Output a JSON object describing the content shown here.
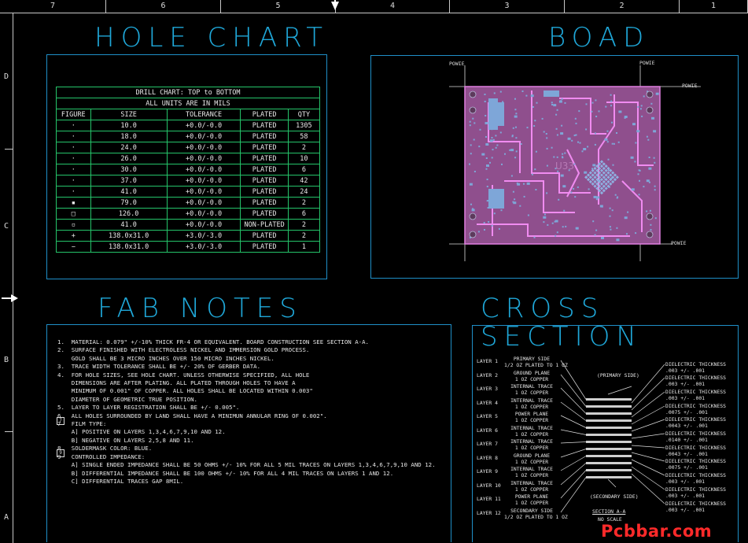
{
  "zones_top": [
    "7",
    "6",
    "5",
    "4",
    "3",
    "2",
    "1"
  ],
  "zones_left": [
    "D",
    "C",
    "B",
    "A"
  ],
  "titles": {
    "hole_chart": "HOLE CHART",
    "board": "BOAD",
    "fab_notes": "FAB NOTES",
    "cross_section": "CROSS SECTION"
  },
  "drill_chart": {
    "title": "DRILL CHART: TOP to BOTTOM",
    "subtitle": "ALL UNITS ARE IN MILS",
    "headers": [
      "FIGURE",
      "SIZE",
      "TOLERANCE",
      "PLATED",
      "QTY"
    ],
    "rows": [
      [
        "·",
        "10.0",
        "+0.0/-0.0",
        "PLATED",
        "1305"
      ],
      [
        "·",
        "18.0",
        "+0.0/-0.0",
        "PLATED",
        "58"
      ],
      [
        "·",
        "24.0",
        "+0.0/-0.0",
        "PLATED",
        "2"
      ],
      [
        "·",
        "26.0",
        "+0.0/-0.0",
        "PLATED",
        "10"
      ],
      [
        "·",
        "30.0",
        "+0.0/-0.0",
        "PLATED",
        "6"
      ],
      [
        "·",
        "37.0",
        "+0.0/-0.0",
        "PLATED",
        "42"
      ],
      [
        "·",
        "41.0",
        "+0.0/-0.0",
        "PLATED",
        "24"
      ],
      [
        "▪",
        "79.0",
        "+0.0/-0.0",
        "PLATED",
        "2"
      ],
      [
        "□",
        "126.0",
        "+0.0/-0.0",
        "PLATED",
        "6"
      ],
      [
        "▫",
        "41.0",
        "+0.0/-0.0",
        "NON-PLATED",
        "2"
      ],
      [
        "+",
        "138.0x31.0",
        "+3.0/-3.0",
        "PLATED",
        "2"
      ],
      [
        "−",
        "138.0x31.0",
        "+3.0/-3.0",
        "PLATED",
        "1"
      ]
    ]
  },
  "board": {
    "callouts": [
      "POWIE",
      "POWIE",
      "POWIE",
      "POWIE"
    ],
    "label": "U33"
  },
  "fab_notes": [
    "1.  MATERIAL: 0.079\" +/-10% THICK FR-4 OR EQUIVALENT. BOARD CONSTRUCTION SEE SECTION A-A.",
    "2.  SURFACE FINISHED WITH ELECTROLESS NICKEL AND IMMERSION GOLD PROCESS.",
    "    GOLD SHALL BE 3 MICRO INCHES OVER 150 MICRO INCHES NICKEL.",
    "3.  TRACE WIDTH TOLERANCE SHALL BE +/- 20% OF GERBER DATA.",
    "4.  FOR HOLE SIZES, SEE HOLE CHART. UNLESS OTHERWISE SPECIFIED, ALL HOLE",
    "    DIMENSIONS ARE AFTER PLATING. ALL PLATED THROUGH HOLES TO HAVE A",
    "    MINIMUM OF 0.001\" OF COPPER. ALL HOLES SHALL BE LOCATED WITHIN 0.003\"",
    "    DIAMETER OF GEOMETRIC TRUE POSITION.",
    "5.  LAYER TO LAYER REGISTRATION SHALL BE +/- 0.005\".",
    "6.  ALL HOLES SURROUNDED BY LAND SHALL HAVE A MINIMUN ANNULAR RING OF 0.002\".",
    "7   FILM TYPE:",
    "    A] POSITIVE ON LAYERS 1,3,4,6,7,9,10 AND 12.",
    "    B] NEGATIVE ON LAYERS 2,5,8 AND 11.",
    "8.  SOLDERMASK COLOR: BLUE.",
    "9   CONTROLLED IMPEDANCE:",
    "    A] SINGLE ENDED IMPEDANCE SHALL BE 50 OHMS +/- 10% FOR ALL 5 MIL TRACES ON LAYERS 1,3,4,6,7,9,10 AND 12.",
    "    B] DIFFERENTIAL IMPEDANCE SHALL BE 100 OHMS +/- 10% FOR ALL 4 MIL TRACES ON LAYERS 1 AND 12.",
    "    C] DIFFERENTIAL TRACES GAP 8MIL."
  ],
  "cross_section": {
    "layers": [
      {
        "layer": "LAYER 1",
        "desc": "PRIMARY SIDE\n1/2 OZ PLATED TO 1 OZ"
      },
      {
        "layer": "LAYER 2",
        "desc": "GROUND PLANE\n1 OZ COPPER"
      },
      {
        "layer": "LAYER 3",
        "desc": "INTERNAL TRACE\n1 OZ COPPER"
      },
      {
        "layer": "LAYER 4",
        "desc": "INTERNAL TRACE\n1 OZ COPPER"
      },
      {
        "layer": "LAYER 5",
        "desc": "POWER PLANE\n1 OZ COPPER"
      },
      {
        "layer": "LAYER 6",
        "desc": "INTERNAL TRACE\n1 OZ COPPER"
      },
      {
        "layer": "LAYER 7",
        "desc": "INTERNAL TRACE\n1 OZ COPPER"
      },
      {
        "layer": "LAYER 8",
        "desc": "GROUND PLANE\n1 OZ COPPER"
      },
      {
        "layer": "LAYER 9",
        "desc": "INTERNAL TRACE\n1 OZ COPPER"
      },
      {
        "layer": "LAYER 10",
        "desc": "INTERNAL TRACE\n1 OZ COPPER"
      },
      {
        "layer": "LAYER 11",
        "desc": "POWER PLANE\n1 OZ COPPER"
      },
      {
        "layer": "LAYER 12",
        "desc": "SECONDARY SIDE\n1/2 OZ PLATED TO 1 OZ"
      }
    ],
    "dielectrics": [
      "DIELECTRIC THICKNESS\n.003 +/- .001",
      "DIELECTRIC THICKNESS\n.003 +/- .001",
      "DIELECTRIC THICKNESS\n.003 +/- .001",
      "DIELECTRIC THICKNESS\n.0075 +/- .001",
      "DIELECTRIC THICKNESS\n.0043 +/- .001",
      "DIELECTRIC THICKNESS\n.0140 +/- .001",
      "DIELECTRIC THICKNESS\n.0043 +/- .001",
      "DIELECTRIC THICKNESS\n.0075 +/- .001",
      "DIELECTRIC THICKNESS\n.003 +/- .001",
      "DIELECTRIC THICKNESS\n.003 +/- .001",
      "DIELECTRIC THICKNESS\n.003 +/- .001"
    ],
    "primary_label": "(PRIMARY SIDE)",
    "secondary_label": "(SECONDARY SIDE)",
    "section_label": "SECTION A-A",
    "scale_label": "NO SCALE"
  },
  "watermark": "Pcbbar.com",
  "colors": {
    "frame": "#c8c8c8",
    "title": "#1fa7d8",
    "table_border": "#25c46a",
    "board": "#d77ad6",
    "pad": "#7ea6d8",
    "watermark": "#ff2a2a"
  }
}
